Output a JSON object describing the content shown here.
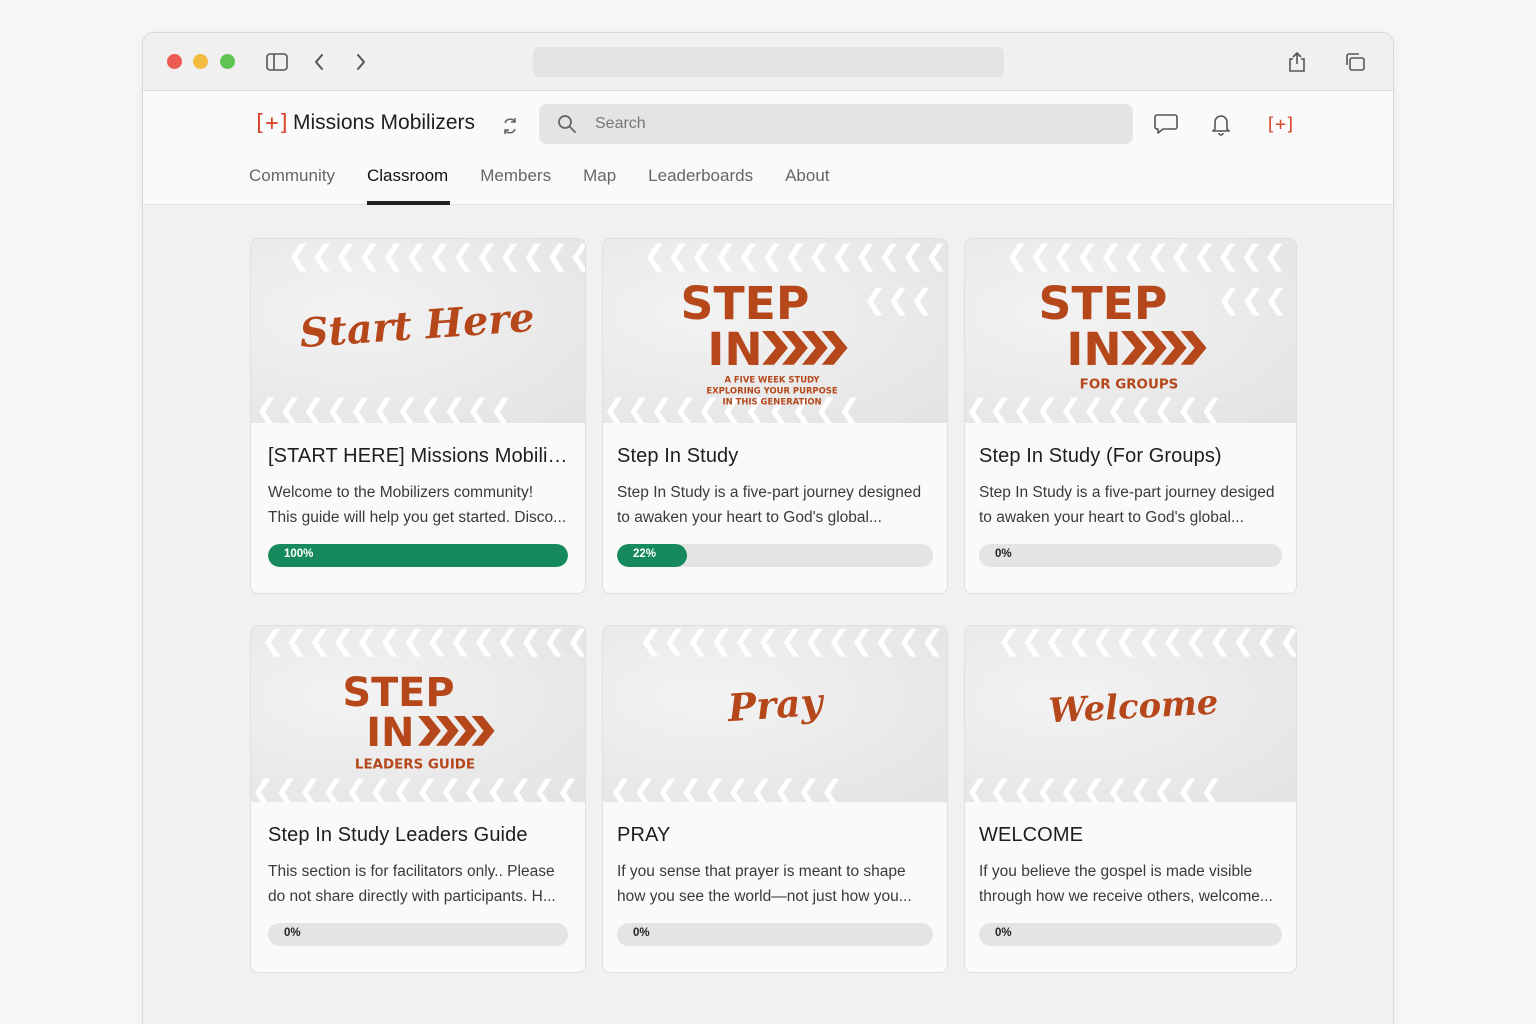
{
  "brand": {
    "mark": "[+]",
    "name": "Missions Mobilizers"
  },
  "search": {
    "placeholder": "Search"
  },
  "tabs": [
    {
      "label": "Community",
      "active": false
    },
    {
      "label": "Classroom",
      "active": true
    },
    {
      "label": "Members",
      "active": false
    },
    {
      "label": "Map",
      "active": false
    },
    {
      "label": "Leaderboards",
      "active": false
    },
    {
      "label": "About",
      "active": false
    }
  ],
  "header_icons": [
    "chat-icon",
    "bell-icon",
    "brand-plus-icon"
  ],
  "colors": {
    "accent": "#d9472b",
    "thumb_text": "#b5471b",
    "progress_fill": "#168a5c"
  },
  "courses": [
    {
      "title": "[START HERE] Missions Mobiliz...",
      "desc": [
        "Welcome to the Mobilizers community!",
        "This guide will help you get started. Disco..."
      ],
      "progress": 100,
      "progress_label": "100%",
      "thumb": {
        "script": "Start Here"
      }
    },
    {
      "title": "Step In Study",
      "desc": [
        "Step In Study is a five-part journey designed",
        "to awaken your heart to God's global..."
      ],
      "progress": 22,
      "progress_label": "22%",
      "thumb": {
        "line1": "STEP",
        "line2": "IN",
        "sub": [
          "A FIVE WEEK STUDY",
          "EXPLORING YOUR PURPOSE",
          "IN THIS GENERATION"
        ]
      }
    },
    {
      "title": "Step In Study (For Groups)",
      "desc": [
        "Step In Study is a five-part journey desiged",
        "to awaken your heart to God's global..."
      ],
      "progress": 0,
      "progress_label": "0%",
      "thumb": {
        "line1": "STEP",
        "line2": "IN",
        "sub": [
          "FOR GROUPS"
        ]
      }
    },
    {
      "title": "Step In Study Leaders Guide",
      "desc": [
        "This section is for facilitators only.. Please",
        "do not share directly with participants. H..."
      ],
      "progress": 0,
      "progress_label": "0%",
      "thumb": {
        "line1": "STEP",
        "line2": "IN",
        "sub": [
          "LEADERS GUIDE"
        ]
      }
    },
    {
      "title": "PRAY",
      "desc": [
        "If you sense that prayer is meant to shape",
        "how you see the world—not just how you..."
      ],
      "progress": 0,
      "progress_label": "0%",
      "thumb": {
        "script": "Pray"
      }
    },
    {
      "title": "WELCOME",
      "desc": [
        "If you believe the gospel is made visible",
        "through how we receive others, welcome..."
      ],
      "progress": 0,
      "progress_label": "0%",
      "thumb": {
        "script": "Welcome"
      }
    }
  ]
}
